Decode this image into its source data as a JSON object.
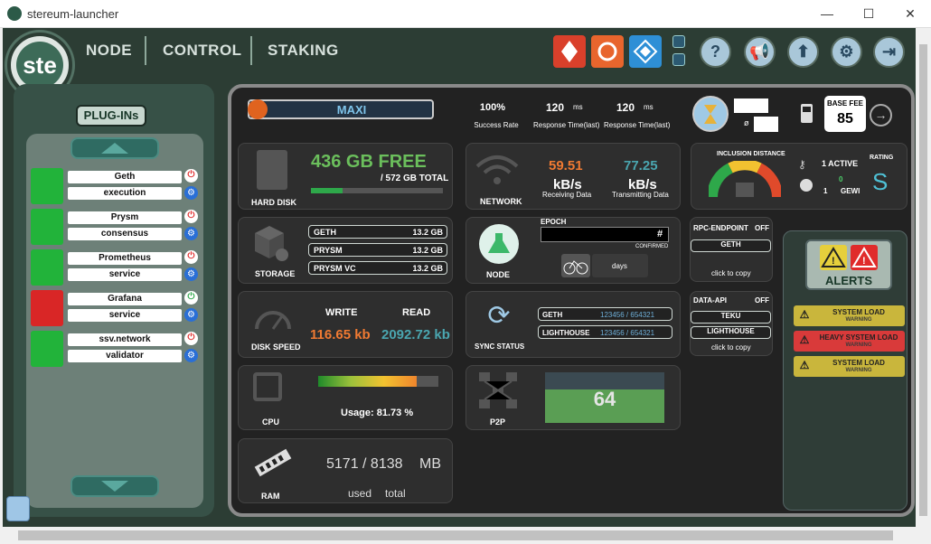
{
  "window": {
    "title": "stereum-launcher",
    "minimize": "—",
    "maximize": "☐",
    "close": "✕"
  },
  "nav": {
    "node": "NODE",
    "control": "CONTROL",
    "staking": "STAKING"
  },
  "logo": {
    "text": "ste"
  },
  "topbar": {
    "icons": [
      "ethereum-client-icon",
      "lighthouse-icon",
      "diamond-icon"
    ],
    "buttons": [
      "?",
      "📢",
      "⬆",
      "⚙",
      "⇥"
    ]
  },
  "plugins": {
    "title": "PLUG-INs",
    "items": [
      {
        "name": "Geth",
        "category": "execution",
        "status_color": "#22b33a",
        "power_color": "#e02b2b"
      },
      {
        "name": "Prysm",
        "category": "consensus",
        "status_color": "#22b33a",
        "power_color": "#e02b2b"
      },
      {
        "name": "Prometheus",
        "category": "service",
        "status_color": "#22b33a",
        "power_color": "#e02b2b"
      },
      {
        "name": "Grafana",
        "category": "service",
        "status_color": "#d92626",
        "power_color": "#2ea84a"
      },
      {
        "name": "ssv.network",
        "category": "validator",
        "status_color": "#22b33a",
        "power_color": "#e02b2b"
      }
    ]
  },
  "header": {
    "preset": "MAXI",
    "stats": [
      {
        "value": "100%",
        "unit": "",
        "label": "Success Rate"
      },
      {
        "value": "120",
        "unit": "ms",
        "label": "Response Time(last)"
      },
      {
        "value": "120",
        "unit": "ms",
        "label": "Response Time(last)"
      }
    ],
    "ø": "ø",
    "base_fee_label": "BASE FEE",
    "base_fee": "85"
  },
  "harddisk": {
    "free": "436 GB FREE",
    "total": "/ 572 GB TOTAL",
    "label": "HARD DISK",
    "used_fraction": 0.24
  },
  "network": {
    "label": "NETWORK",
    "receiving": "59.51",
    "transmitting": "77.25",
    "unit": "kB/s",
    "receiving_label": "Receiving Data",
    "transmitting_label": "Transmitting Data"
  },
  "inclusion": {
    "title": "INCLUSION DISTANCE",
    "active": "1 ACTIVE",
    "rating_label": "RATING",
    "rating": "S",
    "count_zero": "0",
    "count_one": "1",
    "gewi": "GEWI"
  },
  "storage": {
    "label": "STORAGE",
    "rows": [
      {
        "name": "GETH",
        "size": "13.2 GB"
      },
      {
        "name": "PRYSM",
        "size": "13.2 GB"
      },
      {
        "name": "PRYSM VC",
        "size": "13.2 GB"
      }
    ]
  },
  "node": {
    "label": "NODE",
    "epoch": "EPOCH",
    "hash": "#",
    "confirmed": "CONFIRMED",
    "days": "days"
  },
  "rpc": {
    "label": "RPC-ENDPOINT",
    "state": "OFF",
    "client": "GETH",
    "copy": "click to copy"
  },
  "dataapi": {
    "label": "DATA-API",
    "state": "OFF",
    "client1": "TEKU",
    "client2": "LIGHTHOUSE",
    "copy": "click to copy"
  },
  "diskspeed": {
    "label": "DISK SPEED",
    "write_label": "WRITE",
    "read_label": "READ",
    "write": "116.65 kb",
    "read": "2092.72 kb"
  },
  "sync": {
    "label": "SYNC STATUS",
    "rows": [
      {
        "name": "GETH",
        "value": "123456 / 654321"
      },
      {
        "name": "LIGHTHOUSE",
        "value": "123456 / 654321"
      }
    ]
  },
  "cpu": {
    "label": "CPU",
    "usage": "Usage: 81.73 %",
    "fraction": 0.8173
  },
  "p2p": {
    "label": "P2P",
    "value": "64"
  },
  "ram": {
    "label": "RAM",
    "value": "5171 / 8138",
    "unit": "MB",
    "used": "used",
    "total": "total"
  },
  "alerts": {
    "title": "ALERTS",
    "items": [
      {
        "title": "SYSTEM LOAD",
        "sub": "WARNING",
        "color": "#c9b63c"
      },
      {
        "title": "HEAVY SYSTEM LOAD",
        "sub": "WARNING",
        "color": "#d93a3a"
      },
      {
        "title": "SYSTEM LOAD",
        "sub": "WARNING",
        "color": "#c9b63c"
      }
    ]
  },
  "colors": {
    "accent_green": "#4fae6a",
    "free_green": "#6bbf5c",
    "orange": "#f07a32",
    "teal": "#4aa6b0"
  }
}
